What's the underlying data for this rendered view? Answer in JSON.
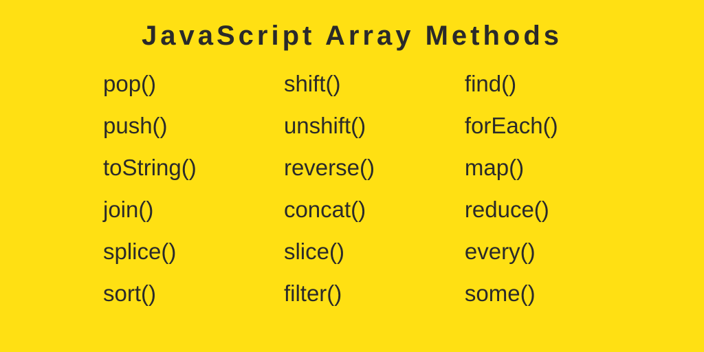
{
  "title": "JavaScript Array Methods",
  "columns": [
    {
      "items": [
        "pop()",
        "push()",
        "toString()",
        "join()",
        "splice()",
        "sort()"
      ]
    },
    {
      "items": [
        "shift()",
        "unshift()",
        "reverse()",
        "concat()",
        "slice()",
        "filter()"
      ]
    },
    {
      "items": [
        "find()",
        "forEach()",
        "map()",
        "reduce()",
        "every()",
        "some()"
      ]
    }
  ]
}
